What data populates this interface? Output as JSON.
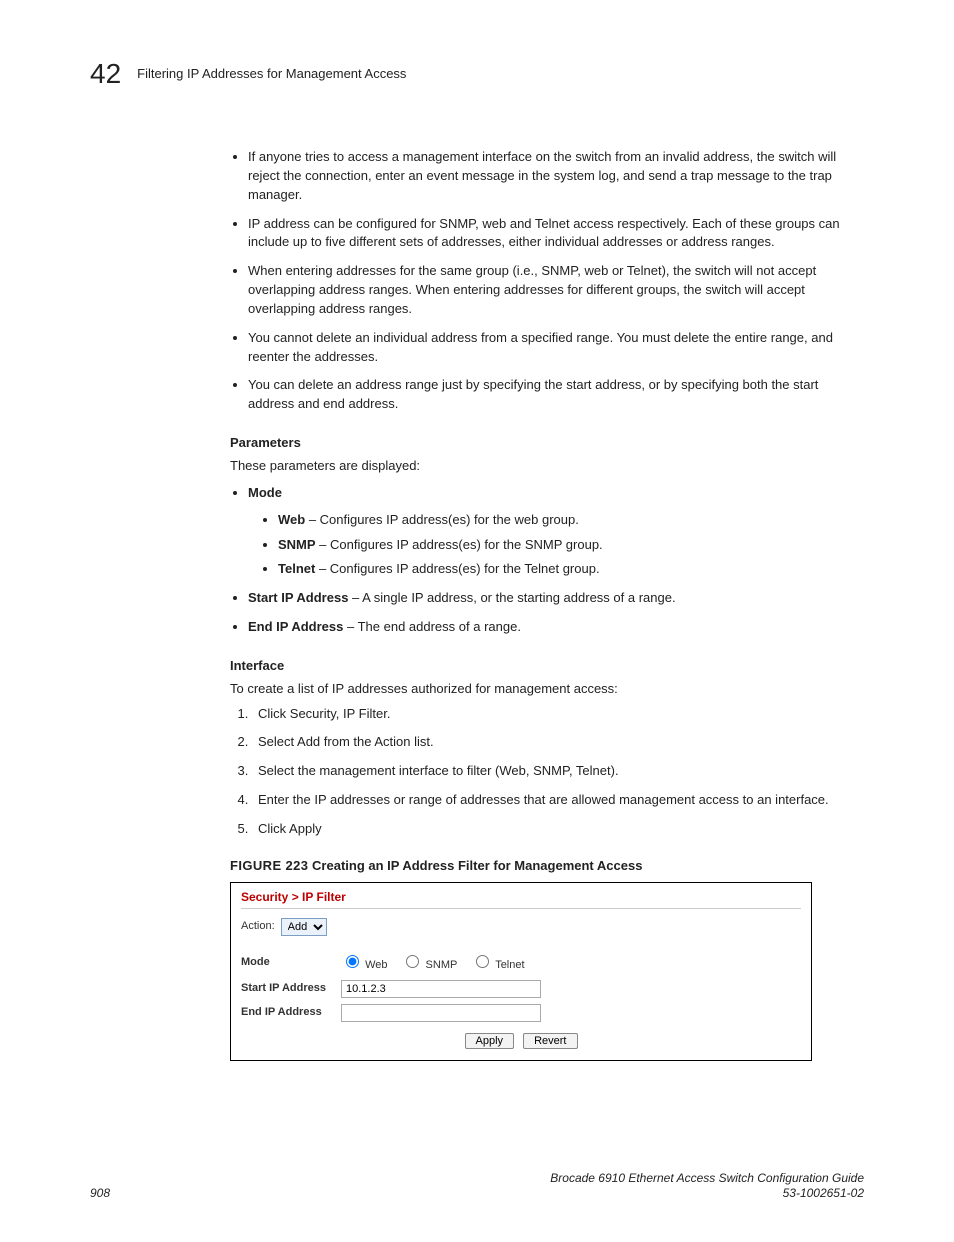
{
  "header": {
    "chapter_number": "42",
    "section_title": "Filtering IP Addresses for Management Access"
  },
  "bullets1": [
    "If anyone tries to access a management interface on the switch from an invalid address, the switch will reject the connection, enter an event message in the system log, and send a trap message to the trap manager.",
    "IP address can be configured for SNMP, web and Telnet access respectively. Each of these groups can include up to five different sets of addresses, either individual addresses or address ranges.",
    "When entering addresses for the same group (i.e., SNMP, web or Telnet), the switch will not accept overlapping address ranges. When entering addresses for different groups, the switch will accept overlapping address ranges.",
    "You cannot delete an individual address from a specified range. You must delete the entire range, and reenter the addresses.",
    "You can delete an address range just by specifying the start address, or by specifying both the start address and end address."
  ],
  "params_heading": "Parameters",
  "params_intro": "These parameters are displayed:",
  "params": {
    "mode_label": "Mode",
    "mode_items": [
      {
        "bold": "Web",
        "desc": " – Configures IP address(es) for the web group."
      },
      {
        "bold": "SNMP",
        "desc": " – Configures IP address(es) for the SNMP group."
      },
      {
        "bold": "Telnet",
        "desc": " – Configures IP address(es) for the Telnet group."
      }
    ],
    "start_ip_bold": "Start IP Address",
    "start_ip_desc": " – A single IP address, or the starting address of a range.",
    "end_ip_bold": "End IP Address",
    "end_ip_desc": " – The end address of a range."
  },
  "interface_heading": "Interface",
  "interface_intro": "To create a list of IP addresses authorized for management access:",
  "steps": [
    "Click Security, IP Filter.",
    "Select Add from the Action list.",
    "Select the management interface to filter (Web, SNMP, Telnet).",
    "Enter the IP addresses or range of addresses that are allowed management access to an interface.",
    "Click Apply"
  ],
  "figure": {
    "label": "FIGURE 223",
    "title": "  Creating an IP Address Filter for Management Access",
    "breadcrumb": "Security > IP Filter",
    "action_label": "Action:",
    "action_value": "Add",
    "mode_label": "Mode",
    "mode_web": "Web",
    "mode_snmp": "SNMP",
    "mode_telnet": "Telnet",
    "start_ip_label": "Start IP Address",
    "start_ip_value": "10.1.2.3",
    "end_ip_label": "End IP Address",
    "end_ip_value": "",
    "apply_btn": "Apply",
    "revert_btn": "Revert"
  },
  "footer": {
    "page_number": "908",
    "guide_title": "Brocade 6910 Ethernet Access Switch Configuration Guide",
    "doc_number": "53-1002651-02"
  }
}
